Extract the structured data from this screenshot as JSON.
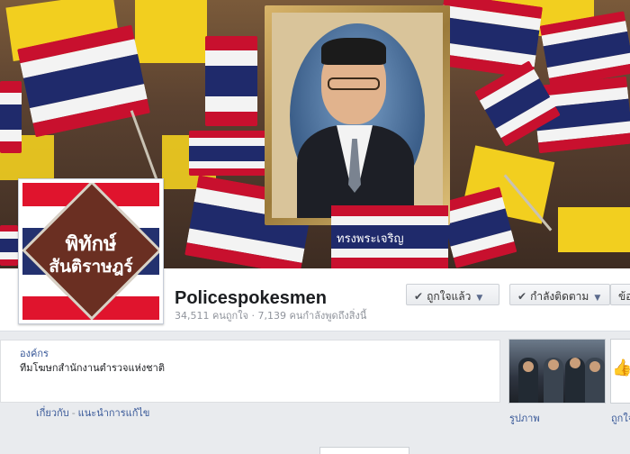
{
  "page": {
    "name": "Policespokesmen",
    "stats": "34,511 คนถูกใจ · 7,139 คนกำลังพูดถึงสิ่งนี้"
  },
  "profile_picture": {
    "line1": "พิทักษ์",
    "line2": "สันติราษฎร์"
  },
  "cover": {
    "banner_text": "ทรงพระเจริญ"
  },
  "actions": {
    "like_label": "ถูกใจแล้ว",
    "follow_label": "กำลังติดตาม",
    "message_label": "ข้อ"
  },
  "about": {
    "category": "องค์กร",
    "description": "ทีมโฆษกสำนักงานตำรวจแห่งชาติ",
    "link_about": "เกี่ยวกับ",
    "link_suggest": "แนะนำการแก้ไข"
  },
  "apps": {
    "photos_label": "รูปภาพ",
    "likes_label": "ถูกใจ"
  },
  "colors": {
    "thai_red": "#c8102e",
    "thai_blue": "#1f2a6b",
    "royal_yellow": "#f2cf1f",
    "link_blue": "#385898"
  },
  "icons": [
    "check-icon",
    "caret-down-icon",
    "thumbs-up-icon"
  ]
}
